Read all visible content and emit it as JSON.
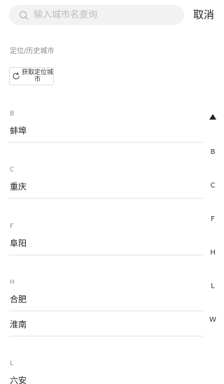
{
  "search": {
    "placeholder": "输入城市名查询",
    "value": "",
    "cancel_label": "取消"
  },
  "location": {
    "title": "定位/历史城市",
    "button_label": "获取定位城市"
  },
  "groups": [
    {
      "letter": "B",
      "cities": [
        "蚌埠"
      ]
    },
    {
      "letter": "C",
      "cities": [
        "重庆"
      ]
    },
    {
      "letter": "F",
      "cities": [
        "阜阳"
      ]
    },
    {
      "letter": "H",
      "cities": [
        "合肥",
        "淮南"
      ]
    },
    {
      "letter": "L",
      "cities": [
        "六安"
      ]
    }
  ],
  "index": {
    "top_icon": "triangle-up-icon",
    "letters": [
      "B",
      "C",
      "F",
      "H",
      "L",
      "W"
    ]
  }
}
